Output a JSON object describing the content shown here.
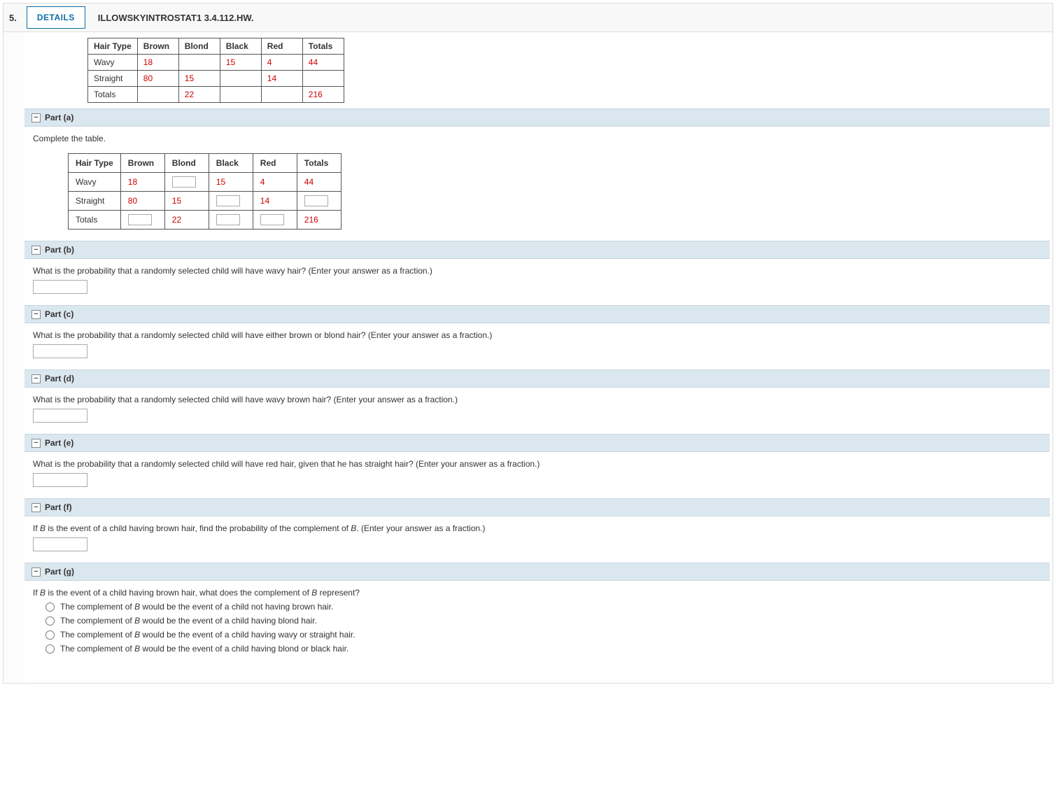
{
  "header": {
    "number": "5.",
    "details": "DETAILS",
    "ref": "ILLOWSKYINTROSTAT1 3.4.112.HW."
  },
  "table_headers": [
    "Hair Type",
    "Brown",
    "Blond",
    "Black",
    "Red",
    "Totals"
  ],
  "top_table": {
    "wavy": {
      "label": "Wavy",
      "brown": "18",
      "blond": "",
      "black": "15",
      "red": "4",
      "totals": "44"
    },
    "straight": {
      "label": "Straight",
      "brown": "80",
      "blond": "15",
      "black": "",
      "red": "14",
      "totals": ""
    },
    "totals": {
      "label": "Totals",
      "brown": "",
      "blond": "22",
      "black": "",
      "red": "",
      "totals": "216"
    }
  },
  "part_a": {
    "title": "Part (a)",
    "prompt": "Complete the table.",
    "rows": {
      "wavy": {
        "label": "Wavy",
        "brown": "18",
        "blond_input": true,
        "black": "15",
        "red": "4",
        "totals": "44"
      },
      "straight": {
        "label": "Straight",
        "brown": "80",
        "blond": "15",
        "black_input": true,
        "red": "14",
        "totals_input": true
      },
      "totals": {
        "label": "Totals",
        "brown_input": true,
        "blond": "22",
        "black_input": true,
        "red_input": true,
        "totals": "216"
      }
    }
  },
  "part_b": {
    "title": "Part (b)",
    "prompt": "What is the probability that a randomly selected child will have wavy hair? (Enter your answer as a fraction.)"
  },
  "part_c": {
    "title": "Part (c)",
    "prompt": "What is the probability that a randomly selected child will have either brown or blond hair? (Enter your answer as a fraction.)"
  },
  "part_d": {
    "title": "Part (d)",
    "prompt": "What is the probability that a randomly selected child will have wavy brown hair? (Enter your answer as a fraction.)"
  },
  "part_e": {
    "title": "Part (e)",
    "prompt": "What is the probability that a randomly selected child will have red hair, given that he has straight hair? (Enter your answer as a fraction.)"
  },
  "part_f": {
    "title": "Part (f)",
    "prompt_pre": "If ",
    "prompt_var": "B",
    "prompt_mid": " is the event of a child having brown hair, find the probability of the complement of ",
    "prompt_var2": "B",
    "prompt_post": ". (Enter your answer as a fraction.)"
  },
  "part_g": {
    "title": "Part (g)",
    "prompt_pre": "If ",
    "prompt_var": "B",
    "prompt_mid": " is the event of a child having brown hair, what does the complement of ",
    "prompt_var2": "B",
    "prompt_post": " represent?",
    "options": [
      {
        "pre": "The complement of ",
        "var": "B",
        "post": " would be the event of a child not having brown hair."
      },
      {
        "pre": "The complement of ",
        "var": "B",
        "post": " would be the event of a child having blond hair."
      },
      {
        "pre": "The complement of ",
        "var": "B",
        "post": " would be the event of a child having wavy or straight hair."
      },
      {
        "pre": "The complement of ",
        "var": "B",
        "post": " would be the event of a child having blond or black hair."
      }
    ]
  },
  "collapse_glyph": "−"
}
